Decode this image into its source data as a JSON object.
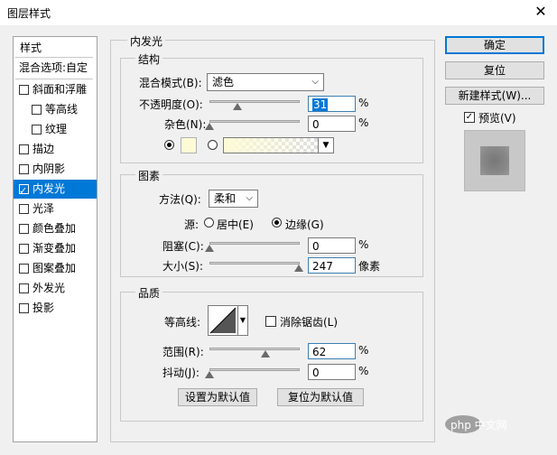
{
  "window": {
    "title": "图层样式"
  },
  "styles_list": {
    "header": "样式",
    "blend_options": "混合选项:自定",
    "items": [
      {
        "label": "斜面和浮雕",
        "checked": false,
        "sub": false
      },
      {
        "label": "等高线",
        "checked": false,
        "sub": true
      },
      {
        "label": "纹理",
        "checked": false,
        "sub": true
      },
      {
        "label": "描边",
        "checked": false,
        "sub": false
      },
      {
        "label": "内阴影",
        "checked": false,
        "sub": false
      },
      {
        "label": "内发光",
        "checked": true,
        "sub": false,
        "selected": true
      },
      {
        "label": "光泽",
        "checked": false,
        "sub": false
      },
      {
        "label": "颜色叠加",
        "checked": false,
        "sub": false
      },
      {
        "label": "渐变叠加",
        "checked": false,
        "sub": false
      },
      {
        "label": "图案叠加",
        "checked": false,
        "sub": false
      },
      {
        "label": "外发光",
        "checked": false,
        "sub": false
      },
      {
        "label": "投影",
        "checked": false,
        "sub": false
      }
    ]
  },
  "panel": {
    "title": "内发光",
    "structure": {
      "label": "结构",
      "blend_mode_label": "混合模式(B):",
      "blend_mode_value": "滤色",
      "opacity_label": "不透明度(O):",
      "opacity_value": "31",
      "opacity_unit": "%",
      "opacity_level": 0.31,
      "noise_label": "杂色(N):",
      "noise_value": "0",
      "noise_unit": "%",
      "noise_level": 0,
      "glow_color": "#fdfbd6"
    },
    "elements": {
      "label": "图素",
      "method_label": "方法(Q):",
      "method_value": "柔和",
      "source_label": "源:",
      "source_center": "居中(E)",
      "source_edge": "边缘(G)",
      "source_selected": "edge",
      "choke_label": "阻塞(C):",
      "choke_value": "0",
      "choke_unit": "%",
      "choke_level": 0,
      "size_label": "大小(S):",
      "size_value": "247",
      "size_unit": "像素",
      "size_level": 0.99
    },
    "quality": {
      "label": "品质",
      "contour_label": "等高线:",
      "antialias_label": "消除锯齿(L)",
      "antialias_checked": false,
      "range_label": "范围(R):",
      "range_value": "62",
      "range_unit": "%",
      "range_level": 0.62,
      "jitter_label": "抖动(J):",
      "jitter_value": "0",
      "jitter_unit": "%",
      "jitter_level": 0
    },
    "buttons": {
      "set_default": "设置为默认值",
      "reset_default": "复位为默认值"
    }
  },
  "actions": {
    "ok": "确定",
    "reset": "复位",
    "new_style": "新建样式(W)...",
    "preview_label": "预览(V)",
    "preview_checked": true
  },
  "watermark": "php 中文网"
}
